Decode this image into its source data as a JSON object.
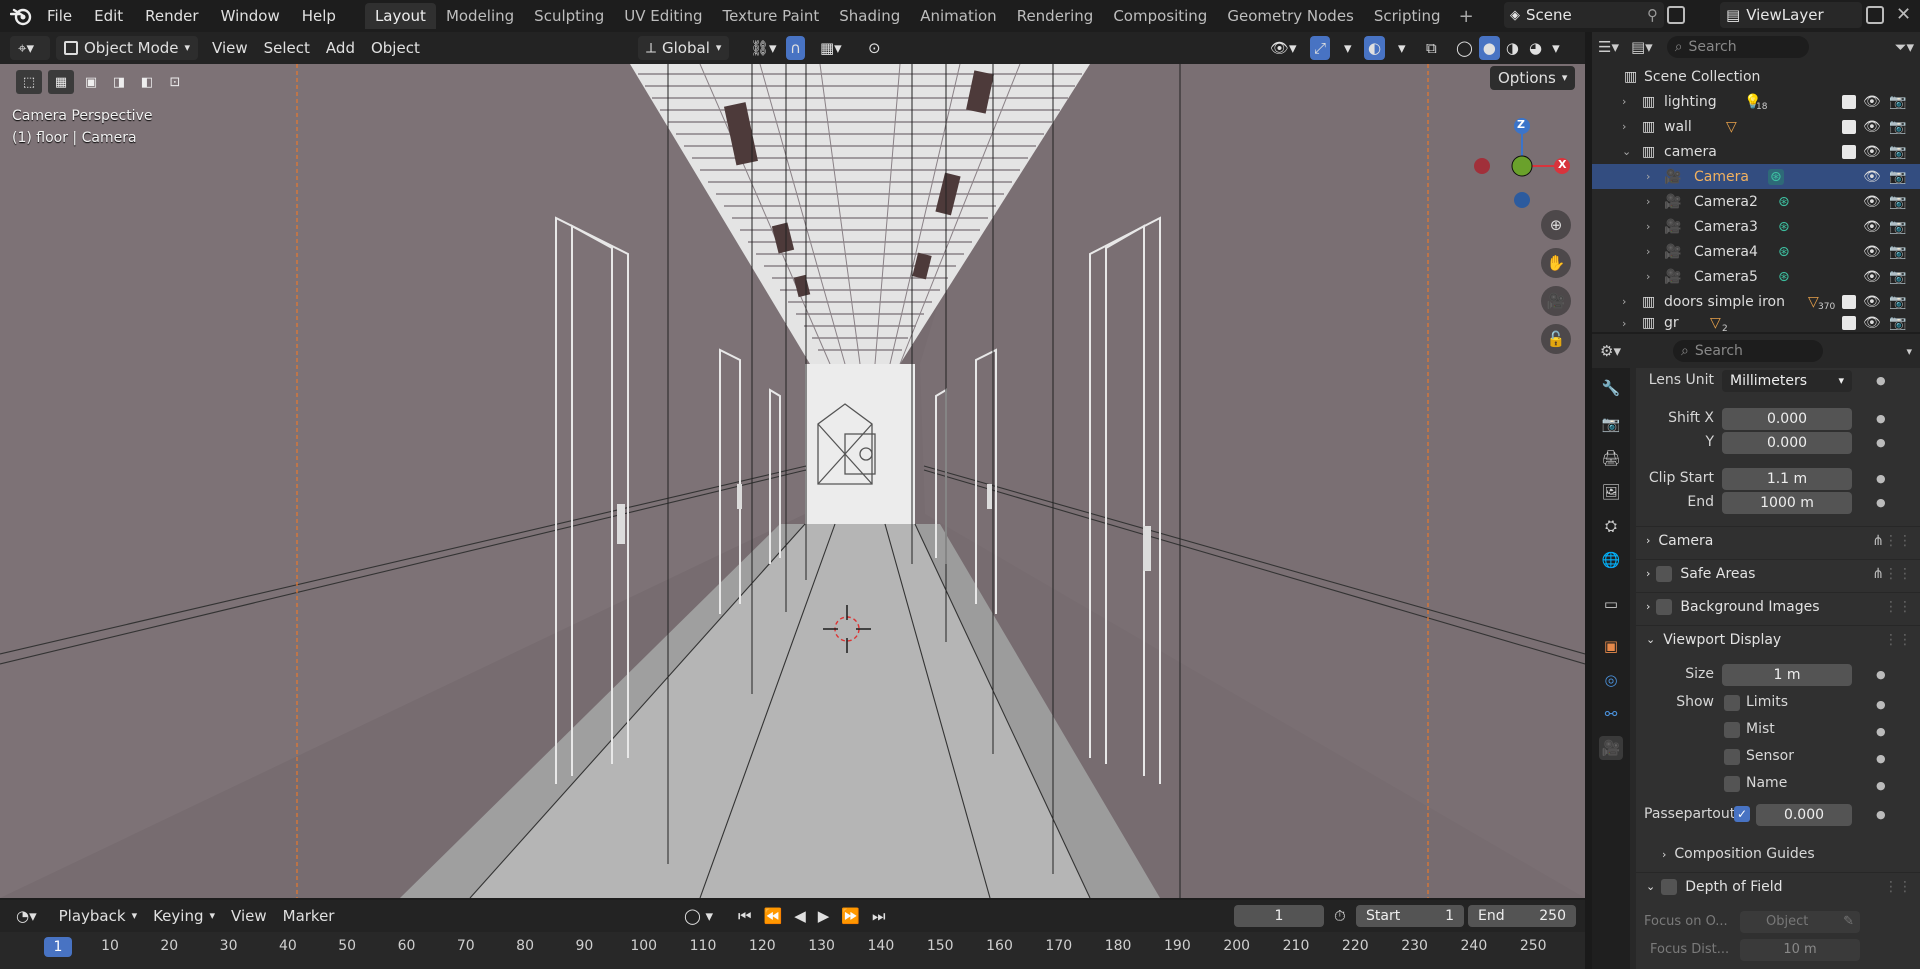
{
  "menu": {
    "items": [
      "File",
      "Edit",
      "Render",
      "Window",
      "Help"
    ]
  },
  "workspaces": {
    "tabs": [
      "Layout",
      "Modeling",
      "Sculpting",
      "UV Editing",
      "Texture Paint",
      "Shading",
      "Animation",
      "Rendering",
      "Compositing",
      "Geometry Nodes",
      "Scripting"
    ],
    "active": "Layout"
  },
  "scene": {
    "name": "Scene",
    "view_layer": "ViewLayer"
  },
  "viewport_header": {
    "mode": "Object Mode",
    "menus": [
      "View",
      "Select",
      "Add",
      "Object"
    ],
    "orientation": "Global",
    "options": "Options"
  },
  "viewport": {
    "perspective": "Camera Perspective",
    "info": "(1) floor | Camera",
    "gizmo_axes": [
      "Z",
      "X"
    ]
  },
  "outliner": {
    "search_placeholder": "Search",
    "root": "Scene Collection",
    "rows": [
      {
        "name": "lighting",
        "badge": "18"
      },
      {
        "name": "wall",
        "badge": ""
      },
      {
        "name": "camera",
        "badge": ""
      },
      {
        "name": "Camera",
        "badge": ""
      },
      {
        "name": "Camera2",
        "badge": ""
      },
      {
        "name": "Camera3",
        "badge": ""
      },
      {
        "name": "Camera4",
        "badge": ""
      },
      {
        "name": "Camera5",
        "badge": ""
      },
      {
        "name": "doors simple iron",
        "badge": "370"
      },
      {
        "name": "gr",
        "badge": "2"
      }
    ]
  },
  "properties": {
    "search_placeholder": "Search",
    "lens_unit_label": "Lens Unit",
    "lens_unit": "Millimeters",
    "shift_x_label": "Shift X",
    "shift_x": "0.000",
    "shift_y_label": "Y",
    "shift_y": "0.000",
    "clip_start_label": "Clip Start",
    "clip_start": "1.1 m",
    "clip_end_label": "End",
    "clip_end": "1000 m",
    "panels": {
      "camera": "Camera",
      "safe_areas": "Safe Areas",
      "background_images": "Background Images",
      "viewport_display": "Viewport Display",
      "composition_guides": "Composition Guides",
      "depth_of_field": "Depth of Field"
    },
    "size_label": "Size",
    "size": "1 m",
    "show_label": "Show",
    "show_options": [
      "Limits",
      "Mist",
      "Sensor",
      "Name"
    ],
    "passepartout_label": "Passepartout",
    "passepartout": "0.000",
    "focus_on_label": "Focus on O...",
    "focus_on_placeholder": "Object",
    "focus_dist_label": "Focus Dist...",
    "focus_dist": "10 m"
  },
  "timeline": {
    "menus": [
      "Playback",
      "Keying",
      "View",
      "Marker"
    ],
    "current_frame": "1",
    "start_label": "Start",
    "start": "1",
    "end_label": "End",
    "end": "250",
    "ticks": [
      "1",
      "10",
      "20",
      "30",
      "40",
      "50",
      "60",
      "70",
      "80",
      "90",
      "100",
      "110",
      "120",
      "130",
      "140",
      "150",
      "160",
      "170",
      "180",
      "190",
      "200",
      "210",
      "220",
      "230",
      "240",
      "250"
    ]
  },
  "colors": {
    "accent": "#4873c3",
    "selection": "#334d80",
    "camera_icon": "#e6894a",
    "camera_data": "#3ec3a3",
    "axis_x": "#d8343c",
    "axis_y": "#6aa12b",
    "axis_z": "#3b74c9"
  }
}
